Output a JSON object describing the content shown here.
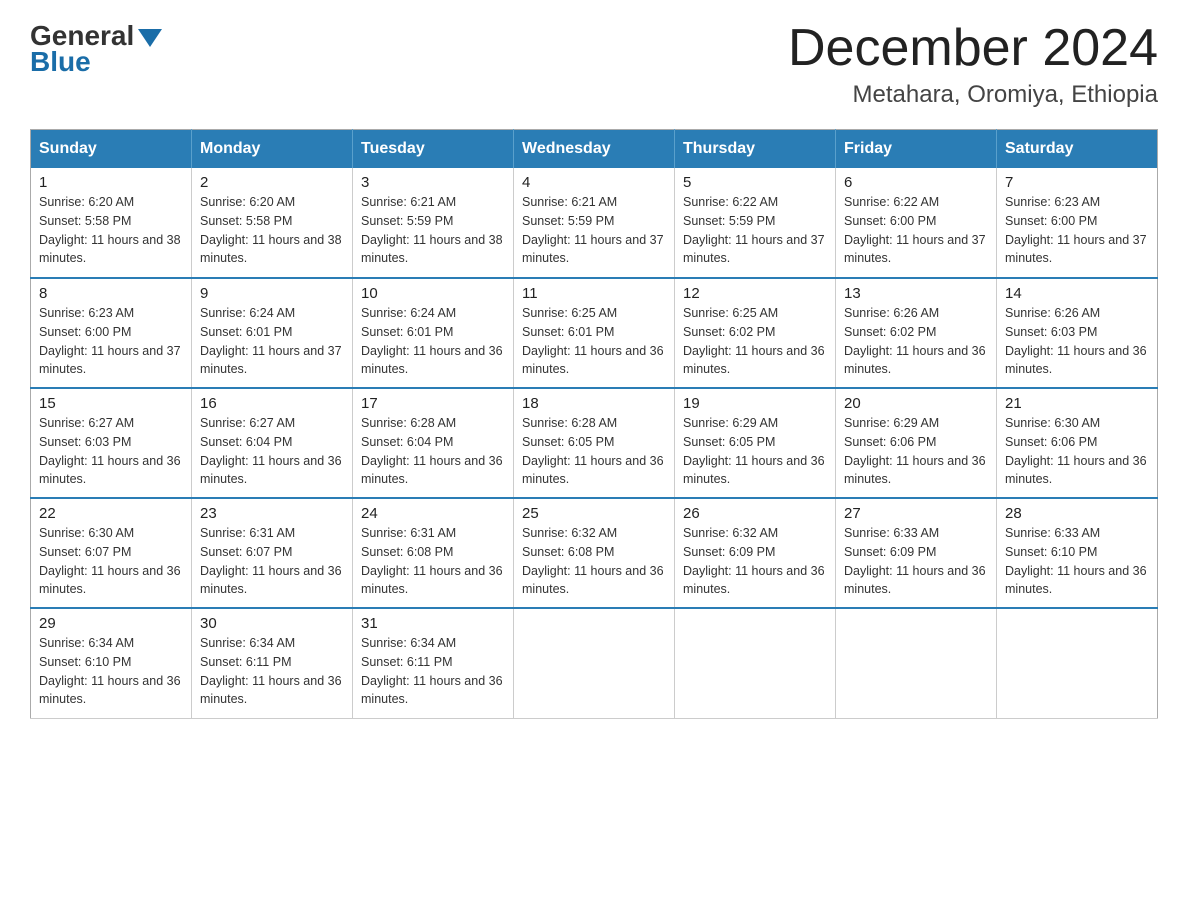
{
  "logo": {
    "general": "General",
    "blue": "Blue"
  },
  "title": "December 2024",
  "subtitle": "Metahara, Oromiya, Ethiopia",
  "weekdays": [
    "Sunday",
    "Monday",
    "Tuesday",
    "Wednesday",
    "Thursday",
    "Friday",
    "Saturday"
  ],
  "weeks": [
    [
      {
        "day": "1",
        "sunrise": "6:20 AM",
        "sunset": "5:58 PM",
        "daylight": "11 hours and 38 minutes."
      },
      {
        "day": "2",
        "sunrise": "6:20 AM",
        "sunset": "5:58 PM",
        "daylight": "11 hours and 38 minutes."
      },
      {
        "day": "3",
        "sunrise": "6:21 AM",
        "sunset": "5:59 PM",
        "daylight": "11 hours and 38 minutes."
      },
      {
        "day": "4",
        "sunrise": "6:21 AM",
        "sunset": "5:59 PM",
        "daylight": "11 hours and 37 minutes."
      },
      {
        "day": "5",
        "sunrise": "6:22 AM",
        "sunset": "5:59 PM",
        "daylight": "11 hours and 37 minutes."
      },
      {
        "day": "6",
        "sunrise": "6:22 AM",
        "sunset": "6:00 PM",
        "daylight": "11 hours and 37 minutes."
      },
      {
        "day": "7",
        "sunrise": "6:23 AM",
        "sunset": "6:00 PM",
        "daylight": "11 hours and 37 minutes."
      }
    ],
    [
      {
        "day": "8",
        "sunrise": "6:23 AM",
        "sunset": "6:00 PM",
        "daylight": "11 hours and 37 minutes."
      },
      {
        "day": "9",
        "sunrise": "6:24 AM",
        "sunset": "6:01 PM",
        "daylight": "11 hours and 37 minutes."
      },
      {
        "day": "10",
        "sunrise": "6:24 AM",
        "sunset": "6:01 PM",
        "daylight": "11 hours and 36 minutes."
      },
      {
        "day": "11",
        "sunrise": "6:25 AM",
        "sunset": "6:01 PM",
        "daylight": "11 hours and 36 minutes."
      },
      {
        "day": "12",
        "sunrise": "6:25 AM",
        "sunset": "6:02 PM",
        "daylight": "11 hours and 36 minutes."
      },
      {
        "day": "13",
        "sunrise": "6:26 AM",
        "sunset": "6:02 PM",
        "daylight": "11 hours and 36 minutes."
      },
      {
        "day": "14",
        "sunrise": "6:26 AM",
        "sunset": "6:03 PM",
        "daylight": "11 hours and 36 minutes."
      }
    ],
    [
      {
        "day": "15",
        "sunrise": "6:27 AM",
        "sunset": "6:03 PM",
        "daylight": "11 hours and 36 minutes."
      },
      {
        "day": "16",
        "sunrise": "6:27 AM",
        "sunset": "6:04 PM",
        "daylight": "11 hours and 36 minutes."
      },
      {
        "day": "17",
        "sunrise": "6:28 AM",
        "sunset": "6:04 PM",
        "daylight": "11 hours and 36 minutes."
      },
      {
        "day": "18",
        "sunrise": "6:28 AM",
        "sunset": "6:05 PM",
        "daylight": "11 hours and 36 minutes."
      },
      {
        "day": "19",
        "sunrise": "6:29 AM",
        "sunset": "6:05 PM",
        "daylight": "11 hours and 36 minutes."
      },
      {
        "day": "20",
        "sunrise": "6:29 AM",
        "sunset": "6:06 PM",
        "daylight": "11 hours and 36 minutes."
      },
      {
        "day": "21",
        "sunrise": "6:30 AM",
        "sunset": "6:06 PM",
        "daylight": "11 hours and 36 minutes."
      }
    ],
    [
      {
        "day": "22",
        "sunrise": "6:30 AM",
        "sunset": "6:07 PM",
        "daylight": "11 hours and 36 minutes."
      },
      {
        "day": "23",
        "sunrise": "6:31 AM",
        "sunset": "6:07 PM",
        "daylight": "11 hours and 36 minutes."
      },
      {
        "day": "24",
        "sunrise": "6:31 AM",
        "sunset": "6:08 PM",
        "daylight": "11 hours and 36 minutes."
      },
      {
        "day": "25",
        "sunrise": "6:32 AM",
        "sunset": "6:08 PM",
        "daylight": "11 hours and 36 minutes."
      },
      {
        "day": "26",
        "sunrise": "6:32 AM",
        "sunset": "6:09 PM",
        "daylight": "11 hours and 36 minutes."
      },
      {
        "day": "27",
        "sunrise": "6:33 AM",
        "sunset": "6:09 PM",
        "daylight": "11 hours and 36 minutes."
      },
      {
        "day": "28",
        "sunrise": "6:33 AM",
        "sunset": "6:10 PM",
        "daylight": "11 hours and 36 minutes."
      }
    ],
    [
      {
        "day": "29",
        "sunrise": "6:34 AM",
        "sunset": "6:10 PM",
        "daylight": "11 hours and 36 minutes."
      },
      {
        "day": "30",
        "sunrise": "6:34 AM",
        "sunset": "6:11 PM",
        "daylight": "11 hours and 36 minutes."
      },
      {
        "day": "31",
        "sunrise": "6:34 AM",
        "sunset": "6:11 PM",
        "daylight": "11 hours and 36 minutes."
      },
      null,
      null,
      null,
      null
    ]
  ]
}
